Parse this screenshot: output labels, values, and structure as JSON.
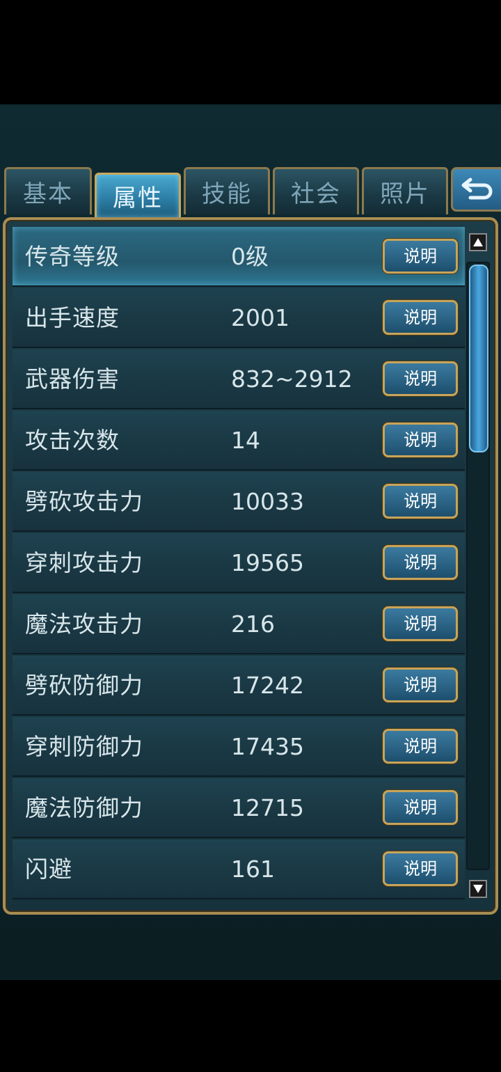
{
  "tabs": [
    {
      "label": "基本",
      "active": false
    },
    {
      "label": "属性",
      "active": true
    },
    {
      "label": "技能",
      "active": false
    },
    {
      "label": "社会",
      "active": false
    },
    {
      "label": "照片",
      "active": false
    }
  ],
  "back_icon": "return-arrow-icon",
  "attributes": [
    {
      "name": "传奇等级",
      "value": "0级",
      "button": "说明",
      "selected": true
    },
    {
      "name": "出手速度",
      "value": "2001",
      "button": "说明"
    },
    {
      "name": "武器伤害",
      "value": "832~2912",
      "button": "说明"
    },
    {
      "name": "攻击次数",
      "value": "14",
      "button": "说明"
    },
    {
      "name": "劈砍攻击力",
      "value": "10033",
      "button": "说明"
    },
    {
      "name": "穿刺攻击力",
      "value": "19565",
      "button": "说明"
    },
    {
      "name": "魔法攻击力",
      "value": "216",
      "button": "说明"
    },
    {
      "name": "劈砍防御力",
      "value": "17242",
      "button": "说明"
    },
    {
      "name": "穿刺防御力",
      "value": "17435",
      "button": "说明"
    },
    {
      "name": "魔法防御力",
      "value": "12715",
      "button": "说明"
    },
    {
      "name": "闪避",
      "value": "161",
      "button": "说明"
    }
  ],
  "system_nav": [
    "back-triangle-icon",
    "home-circle-icon",
    "recents-square-icon"
  ],
  "colors": {
    "tab_active": "#3a94bf",
    "frame_gold": "#c7a45a",
    "row_bg": "#1a3945",
    "text": "#d8e6ea"
  }
}
